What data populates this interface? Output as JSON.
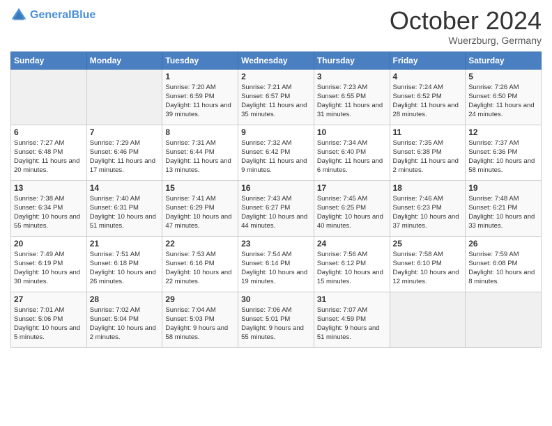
{
  "header": {
    "logo_line1": "General",
    "logo_line2": "Blue",
    "month": "October 2024",
    "location": "Wuerzburg, Germany"
  },
  "days_of_week": [
    "Sunday",
    "Monday",
    "Tuesday",
    "Wednesday",
    "Thursday",
    "Friday",
    "Saturday"
  ],
  "weeks": [
    [
      {
        "day": "",
        "info": ""
      },
      {
        "day": "",
        "info": ""
      },
      {
        "day": "1",
        "info": "Sunrise: 7:20 AM\nSunset: 6:59 PM\nDaylight: 11 hours and 39 minutes."
      },
      {
        "day": "2",
        "info": "Sunrise: 7:21 AM\nSunset: 6:57 PM\nDaylight: 11 hours and 35 minutes."
      },
      {
        "day": "3",
        "info": "Sunrise: 7:23 AM\nSunset: 6:55 PM\nDaylight: 11 hours and 31 minutes."
      },
      {
        "day": "4",
        "info": "Sunrise: 7:24 AM\nSunset: 6:52 PM\nDaylight: 11 hours and 28 minutes."
      },
      {
        "day": "5",
        "info": "Sunrise: 7:26 AM\nSunset: 6:50 PM\nDaylight: 11 hours and 24 minutes."
      }
    ],
    [
      {
        "day": "6",
        "info": "Sunrise: 7:27 AM\nSunset: 6:48 PM\nDaylight: 11 hours and 20 minutes."
      },
      {
        "day": "7",
        "info": "Sunrise: 7:29 AM\nSunset: 6:46 PM\nDaylight: 11 hours and 17 minutes."
      },
      {
        "day": "8",
        "info": "Sunrise: 7:31 AM\nSunset: 6:44 PM\nDaylight: 11 hours and 13 minutes."
      },
      {
        "day": "9",
        "info": "Sunrise: 7:32 AM\nSunset: 6:42 PM\nDaylight: 11 hours and 9 minutes."
      },
      {
        "day": "10",
        "info": "Sunrise: 7:34 AM\nSunset: 6:40 PM\nDaylight: 11 hours and 6 minutes."
      },
      {
        "day": "11",
        "info": "Sunrise: 7:35 AM\nSunset: 6:38 PM\nDaylight: 11 hours and 2 minutes."
      },
      {
        "day": "12",
        "info": "Sunrise: 7:37 AM\nSunset: 6:36 PM\nDaylight: 10 hours and 58 minutes."
      }
    ],
    [
      {
        "day": "13",
        "info": "Sunrise: 7:38 AM\nSunset: 6:34 PM\nDaylight: 10 hours and 55 minutes."
      },
      {
        "day": "14",
        "info": "Sunrise: 7:40 AM\nSunset: 6:31 PM\nDaylight: 10 hours and 51 minutes."
      },
      {
        "day": "15",
        "info": "Sunrise: 7:41 AM\nSunset: 6:29 PM\nDaylight: 10 hours and 47 minutes."
      },
      {
        "day": "16",
        "info": "Sunrise: 7:43 AM\nSunset: 6:27 PM\nDaylight: 10 hours and 44 minutes."
      },
      {
        "day": "17",
        "info": "Sunrise: 7:45 AM\nSunset: 6:25 PM\nDaylight: 10 hours and 40 minutes."
      },
      {
        "day": "18",
        "info": "Sunrise: 7:46 AM\nSunset: 6:23 PM\nDaylight: 10 hours and 37 minutes."
      },
      {
        "day": "19",
        "info": "Sunrise: 7:48 AM\nSunset: 6:21 PM\nDaylight: 10 hours and 33 minutes."
      }
    ],
    [
      {
        "day": "20",
        "info": "Sunrise: 7:49 AM\nSunset: 6:19 PM\nDaylight: 10 hours and 30 minutes."
      },
      {
        "day": "21",
        "info": "Sunrise: 7:51 AM\nSunset: 6:18 PM\nDaylight: 10 hours and 26 minutes."
      },
      {
        "day": "22",
        "info": "Sunrise: 7:53 AM\nSunset: 6:16 PM\nDaylight: 10 hours and 22 minutes."
      },
      {
        "day": "23",
        "info": "Sunrise: 7:54 AM\nSunset: 6:14 PM\nDaylight: 10 hours and 19 minutes."
      },
      {
        "day": "24",
        "info": "Sunrise: 7:56 AM\nSunset: 6:12 PM\nDaylight: 10 hours and 15 minutes."
      },
      {
        "day": "25",
        "info": "Sunrise: 7:58 AM\nSunset: 6:10 PM\nDaylight: 10 hours and 12 minutes."
      },
      {
        "day": "26",
        "info": "Sunrise: 7:59 AM\nSunset: 6:08 PM\nDaylight: 10 hours and 8 minutes."
      }
    ],
    [
      {
        "day": "27",
        "info": "Sunrise: 7:01 AM\nSunset: 5:06 PM\nDaylight: 10 hours and 5 minutes."
      },
      {
        "day": "28",
        "info": "Sunrise: 7:02 AM\nSunset: 5:04 PM\nDaylight: 10 hours and 2 minutes."
      },
      {
        "day": "29",
        "info": "Sunrise: 7:04 AM\nSunset: 5:03 PM\nDaylight: 9 hours and 58 minutes."
      },
      {
        "day": "30",
        "info": "Sunrise: 7:06 AM\nSunset: 5:01 PM\nDaylight: 9 hours and 55 minutes."
      },
      {
        "day": "31",
        "info": "Sunrise: 7:07 AM\nSunset: 4:59 PM\nDaylight: 9 hours and 51 minutes."
      },
      {
        "day": "",
        "info": ""
      },
      {
        "day": "",
        "info": ""
      }
    ]
  ]
}
